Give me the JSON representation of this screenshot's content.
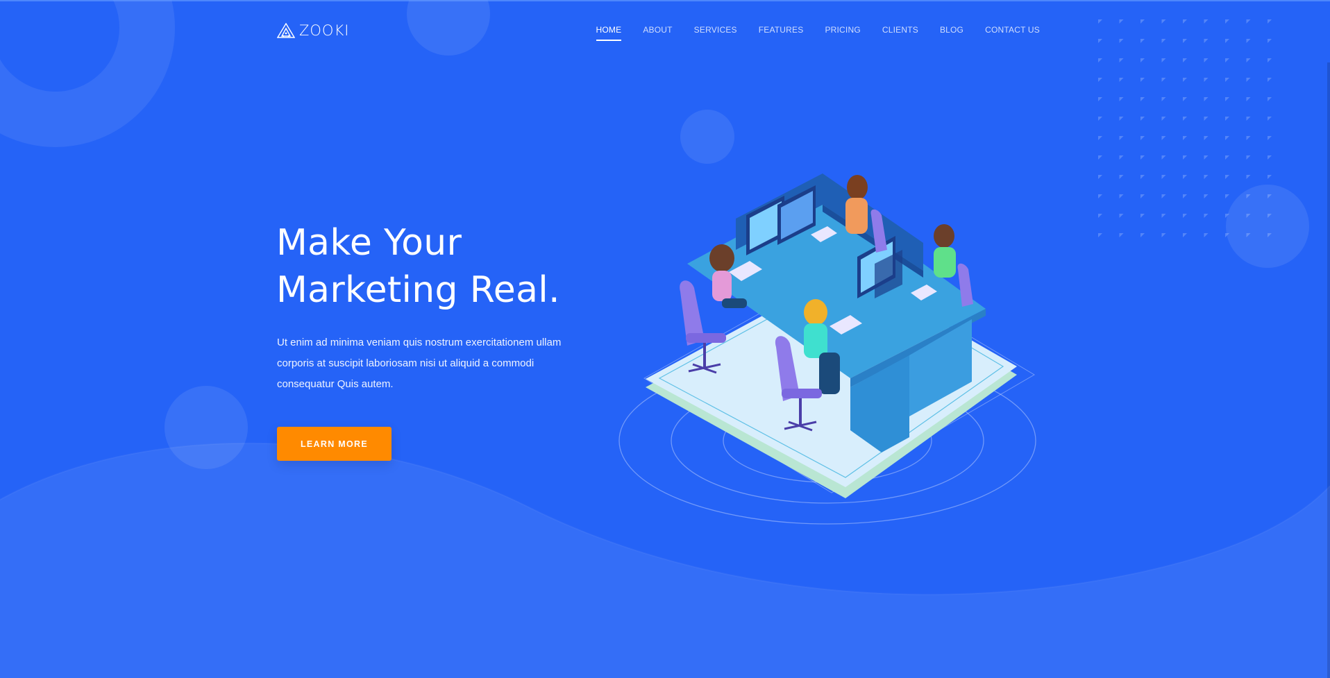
{
  "brand": {
    "name": "ZOOKI",
    "logo_icon": "triangle-logo-icon"
  },
  "nav": {
    "items": [
      {
        "label": "HOME",
        "active": true
      },
      {
        "label": "ABOUT",
        "active": false
      },
      {
        "label": "SERVICES",
        "active": false
      },
      {
        "label": "FEATURES",
        "active": false
      },
      {
        "label": "PRICING",
        "active": false
      },
      {
        "label": "CLIENTS",
        "active": false
      },
      {
        "label": "BLOG",
        "active": false
      },
      {
        "label": "CONTACT US",
        "active": false
      }
    ]
  },
  "hero": {
    "title_line1": "Make Your",
    "title_line2": "Marketing Real.",
    "description": "Ut enim ad minima veniam quis nostrum exercitationem ullam corporis at suscipit laboriosam nisi ut aliquid a commodi consequatur Quis autem.",
    "cta_label": "LEARN MORE",
    "illustration": "isometric-office-team-illustration"
  },
  "colors": {
    "background": "#2563f7",
    "accent": "#ff8a00",
    "text": "#ffffff"
  }
}
